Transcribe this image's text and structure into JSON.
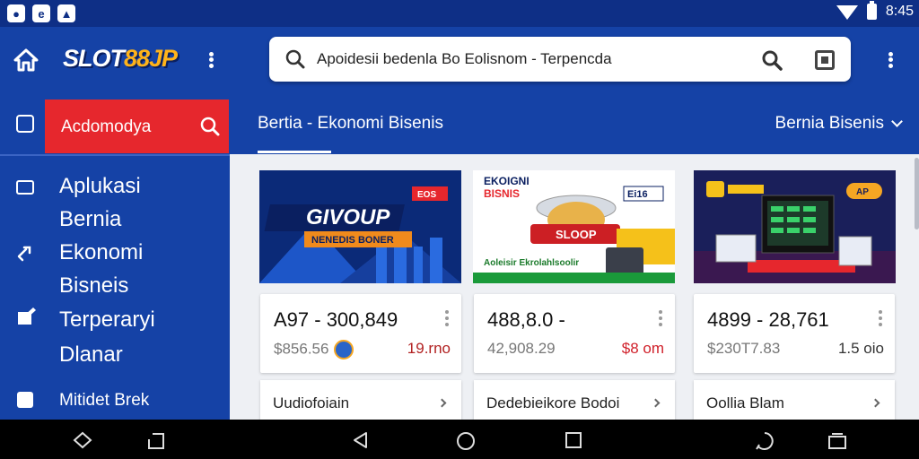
{
  "status_bar": {
    "time": "8:45",
    "icons": [
      "notification-icon",
      "app-icon",
      "image-icon",
      "wifi-icon",
      "battery-icon"
    ]
  },
  "app_bar": {
    "logo_part1": "SLOT",
    "logo_part2": "88JP",
    "search": {
      "value": "Apoidesii bedenla  Bo Eolisnom - Terpencda"
    }
  },
  "sidebar": {
    "header_label": "Acdomodya",
    "items": [
      {
        "lines": [
          "Aplukasi",
          "Bernia",
          "Ekonomi",
          "Bisneis"
        ],
        "icon": "tablet-icon"
      },
      {
        "label": "Terperaryi",
        "icon": "edit-icon"
      },
      {
        "label": "Dlanar"
      },
      {
        "label": "Mitidet Brek",
        "icon": "bag-icon"
      }
    ]
  },
  "tabs": {
    "active": "Bertia - Ekonomi Bisenis",
    "dropdown": "Bernia Bisenis"
  },
  "thumbnails": [
    {
      "headline": "GIVOUP",
      "banner": "NENEDIS BONER",
      "badge": "EOS"
    },
    {
      "title_lines": [
        "EKOIGNI",
        "BISNIS"
      ],
      "ribbon": "SLOOP",
      "badge": "Ei16",
      "footer": "Aoleisir Ekrolahlsoolir"
    },
    {
      "badge": "AP"
    }
  ],
  "cards": [
    {
      "price": "A97 - 300,849",
      "sub_left": "$856.56",
      "sub_right": "19.rno",
      "sub_right_color": "#b22222"
    },
    {
      "price": "488,8.0 -",
      "sub_left": "42,908.29",
      "sub_right": "$8 om",
      "sub_right_color": "#d0202a"
    },
    {
      "price": "4899 - 28,761",
      "sub_left": "$230T7.83",
      "sub_right": "1.5 oio",
      "sub_right_color": "#333333"
    }
  ],
  "cards_secondary": [
    {
      "label": "Uudiofoiain"
    },
    {
      "label": "Dedebieikore Bodoi"
    },
    {
      "label": "Oollia Blam"
    }
  ],
  "colors": {
    "primary": "#1542a6",
    "accent": "#e6272d",
    "status_bar": "#0e2f86"
  }
}
